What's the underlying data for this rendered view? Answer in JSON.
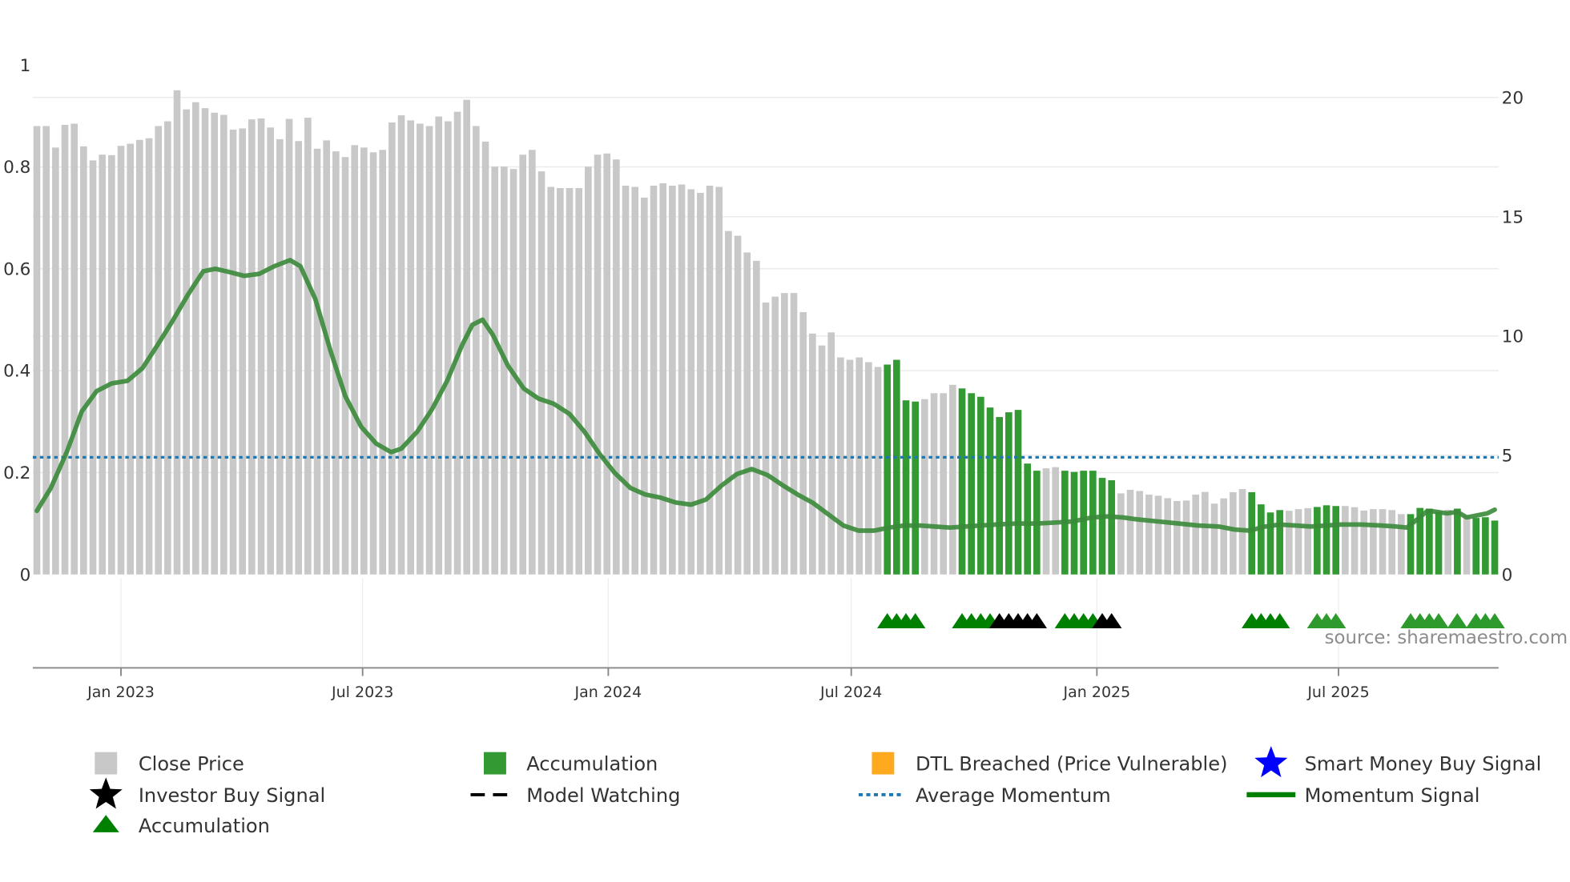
{
  "chart_data": {
    "type": "bar",
    "title": "",
    "xlabel": "",
    "ylabel_left": "",
    "ylabel_right": "",
    "bars": {
      "series_name": "Close Price",
      "start_date": "2022-10-30",
      "frequency": "weekly",
      "values": [
        18.8,
        18.8,
        17.9,
        18.85,
        18.9,
        17.95,
        17.36,
        17.6,
        17.58,
        17.97,
        18.06,
        18.22,
        18.29,
        18.8,
        19.0,
        20.3,
        19.5,
        19.8,
        19.55,
        19.36,
        19.27,
        18.65,
        18.7,
        19.08,
        19.12,
        18.74,
        18.25,
        19.1,
        18.17,
        19.15,
        17.85,
        18.2,
        17.74,
        17.5,
        18.0,
        17.9,
        17.7,
        17.8,
        18.95,
        19.25,
        19.04,
        18.9,
        18.8,
        19.2,
        19.0,
        19.4,
        19.9,
        18.8,
        18.15,
        17.1,
        17.1,
        17.0,
        17.6,
        17.8,
        16.9,
        16.25,
        16.2,
        16.2,
        16.2,
        17.1,
        17.6,
        17.65,
        17.4,
        16.3,
        16.25,
        15.8,
        16.3,
        16.4,
        16.3,
        16.35,
        16.15,
        16.0,
        16.3,
        16.25,
        14.4,
        14.2,
        13.5,
        13.15,
        11.4,
        11.65,
        11.8,
        11.8,
        11.0,
        10.1,
        9.6,
        10.15,
        9.1,
        9.0,
        9.1,
        8.9,
        8.7,
        8.8,
        9.0,
        7.3,
        7.25,
        7.35,
        7.6,
        7.6,
        7.95,
        7.8,
        7.6,
        7.45,
        7.0,
        6.6,
        6.8,
        6.9,
        4.65,
        4.35,
        4.45,
        4.5,
        4.35,
        4.3,
        4.35,
        4.35,
        4.05,
        3.95,
        3.4,
        3.55,
        3.5,
        3.35,
        3.3,
        3.2,
        3.08,
        3.1,
        3.35,
        3.46,
        2.97,
        3.19,
        3.45,
        3.58,
        3.45,
        2.94,
        2.6,
        2.7,
        2.67,
        2.74,
        2.78,
        2.83,
        2.9,
        2.87,
        2.87,
        2.82,
        2.68,
        2.74,
        2.74,
        2.7,
        2.53,
        2.53,
        2.79,
        2.76,
        2.63,
        2.71,
        2.76,
        2.49,
        2.37,
        2.4,
        2.26
      ],
      "accumulation_weeks": [
        91,
        92,
        93,
        94,
        99,
        100,
        101,
        102,
        103,
        104,
        105,
        106,
        107,
        110,
        111,
        112,
        113,
        114,
        115,
        130,
        131,
        132,
        133,
        137,
        138,
        139,
        147,
        148,
        149,
        150,
        152,
        154,
        155,
        156
      ]
    },
    "markers": {
      "accumulation_dark": [
        91,
        92,
        93,
        94,
        99,
        100,
        101,
        102,
        110,
        111,
        112,
        113,
        130,
        131,
        132,
        133
      ],
      "investor_buy": [
        103,
        104,
        105,
        106,
        107,
        114,
        115
      ],
      "accumulation_light": [
        137,
        138,
        139,
        147,
        148,
        149,
        150,
        152,
        154,
        155,
        156
      ]
    },
    "momentum": {
      "series_name": "Momentum Signal",
      "points": [
        [
          0,
          0.125
        ],
        [
          1.5,
          0.17
        ],
        [
          3.2,
          0.24
        ],
        [
          4.8,
          0.32
        ],
        [
          6.4,
          0.36
        ],
        [
          8,
          0.375
        ],
        [
          9.7,
          0.38
        ],
        [
          11.3,
          0.405
        ],
        [
          12.9,
          0.45
        ],
        [
          14.6,
          0.5
        ],
        [
          16.2,
          0.55
        ],
        [
          17.8,
          0.595
        ],
        [
          19.1,
          0.6
        ],
        [
          20.5,
          0.594
        ],
        [
          22.2,
          0.586
        ],
        [
          23.8,
          0.59
        ],
        [
          25.4,
          0.605
        ],
        [
          27.1,
          0.617
        ],
        [
          28.2,
          0.605
        ],
        [
          29.8,
          0.54
        ],
        [
          31.4,
          0.44
        ],
        [
          33,
          0.35
        ],
        [
          34.7,
          0.29
        ],
        [
          36.3,
          0.257
        ],
        [
          37.9,
          0.24
        ],
        [
          39,
          0.247
        ],
        [
          40.7,
          0.28
        ],
        [
          42.3,
          0.325
        ],
        [
          43.9,
          0.38
        ],
        [
          45.5,
          0.45
        ],
        [
          46.6,
          0.49
        ],
        [
          47.7,
          0.5
        ],
        [
          48.8,
          0.47
        ],
        [
          50.4,
          0.41
        ],
        [
          52.1,
          0.365
        ],
        [
          53.7,
          0.345
        ],
        [
          55.3,
          0.335
        ],
        [
          57,
          0.315
        ],
        [
          58.6,
          0.28
        ],
        [
          60.2,
          0.237
        ],
        [
          61.8,
          0.2
        ],
        [
          63.5,
          0.17
        ],
        [
          65.1,
          0.157
        ],
        [
          66.7,
          0.151
        ],
        [
          68.4,
          0.141
        ],
        [
          70,
          0.137
        ],
        [
          71.6,
          0.147
        ],
        [
          73.3,
          0.175
        ],
        [
          74.9,
          0.197
        ],
        [
          76.5,
          0.207
        ],
        [
          78.2,
          0.195
        ],
        [
          79.8,
          0.175
        ],
        [
          81.4,
          0.157
        ],
        [
          83,
          0.141
        ],
        [
          84.7,
          0.118
        ],
        [
          86.3,
          0.096
        ],
        [
          87.9,
          0.086
        ],
        [
          89.6,
          0.086
        ],
        [
          91.2,
          0.092
        ],
        [
          92.8,
          0.096
        ],
        [
          94.5,
          0.096
        ],
        [
          96.1,
          0.094
        ],
        [
          97.7,
          0.092
        ],
        [
          99.3,
          0.094
        ],
        [
          101,
          0.096
        ],
        [
          102.6,
          0.098
        ],
        [
          104.8,
          0.1
        ],
        [
          107,
          0.1
        ],
        [
          109.1,
          0.102
        ],
        [
          110.8,
          0.104
        ],
        [
          112.9,
          0.112
        ],
        [
          114.6,
          0.114
        ],
        [
          116.2,
          0.112
        ],
        [
          117.8,
          0.108
        ],
        [
          120,
          0.104
        ],
        [
          122.2,
          0.1
        ],
        [
          124.3,
          0.096
        ],
        [
          126.5,
          0.094
        ],
        [
          128.2,
          0.088
        ],
        [
          129.8,
          0.086
        ],
        [
          131.4,
          0.094
        ],
        [
          133,
          0.098
        ],
        [
          134.7,
          0.096
        ],
        [
          136.3,
          0.094
        ],
        [
          137.9,
          0.096
        ],
        [
          139.6,
          0.098
        ],
        [
          141.7,
          0.098
        ],
        [
          143.9,
          0.096
        ],
        [
          145.5,
          0.094
        ],
        [
          146.6,
          0.092
        ],
        [
          147.7,
          0.108
        ],
        [
          148.8,
          0.125
        ],
        [
          149.8,
          0.123
        ],
        [
          150.9,
          0.12
        ],
        [
          152,
          0.123
        ],
        [
          153,
          0.112
        ],
        [
          154.1,
          0.116
        ],
        [
          155.2,
          0.12
        ],
        [
          156,
          0.127
        ]
      ]
    },
    "average_momentum": 0.23,
    "left_axis": {
      "ylim": [
        0,
        1
      ],
      "ticks": [
        {
          "v": 0,
          "label": "0"
        },
        {
          "v": 0.2,
          "label": "0.2"
        },
        {
          "v": 0.4,
          "label": "0.4"
        },
        {
          "v": 0.6,
          "label": "0.6"
        },
        {
          "v": 0.8,
          "label": "0.8"
        },
        {
          "v": 1,
          "label": "1"
        }
      ]
    },
    "right_axis": {
      "ylim": [
        0,
        20
      ],
      "ticks": [
        {
          "v": 0,
          "label": "0"
        },
        {
          "v": 5,
          "label": "5"
        },
        {
          "v": 10,
          "label": "10"
        },
        {
          "v": 15,
          "label": "15"
        },
        {
          "v": 20,
          "label": "20"
        }
      ]
    },
    "x_ticks": [
      {
        "date": "2023-01-01",
        "label": "Jan 2023"
      },
      {
        "date": "2023-07-01",
        "label": "Jul 2023"
      },
      {
        "date": "2024-01-01",
        "label": "Jan 2024"
      },
      {
        "date": "2024-07-01",
        "label": "Jul 2024"
      },
      {
        "date": "2025-01-01",
        "label": "Jan 2025"
      },
      {
        "date": "2025-07-01",
        "label": "Jul 2025"
      }
    ],
    "grid": true,
    "legend_position": "bottom",
    "legend": [
      {
        "label": "Close Price",
        "icon": "gray-square"
      },
      {
        "label": "Accumulation",
        "icon": "green-square"
      },
      {
        "label": "DTL Breached (Price Vulnerable)",
        "icon": "orange-square"
      },
      {
        "label": "Smart Money Buy Signal",
        "icon": "blue-star"
      },
      {
        "label": "Investor Buy Signal",
        "icon": "black-star"
      },
      {
        "label": "Model Watching",
        "icon": "dashed-line"
      },
      {
        "label": "Average Momentum",
        "icon": "dotted-line"
      },
      {
        "label": "Momentum Signal",
        "icon": "solid-line"
      },
      {
        "label": "Accumulation",
        "icon": "green-triangle"
      }
    ],
    "source": "source: sharemaestro.com"
  },
  "colors": {
    "close_price": "#c8c8c8",
    "accumulation": "#339933",
    "dtl_breached": "#ffa91f",
    "smart_money": "#0000ff",
    "investor_buy": "#000000",
    "average_momentum": "#1f77b4",
    "momentum": "#3a8a3a",
    "marker_dark": "#008000",
    "marker_light": "#2e9a2e"
  }
}
